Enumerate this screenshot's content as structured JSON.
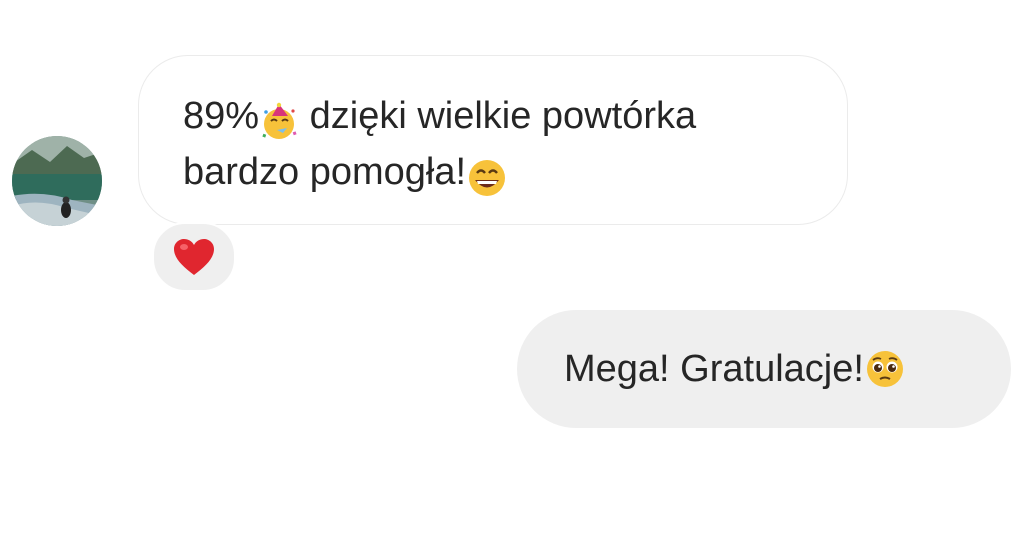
{
  "incoming_message": {
    "line1_prefix": "89%",
    "line1_emoji": "partying-face",
    "line1_text": " dzięki wielkie powtórka",
    "line2_text": "bardzo pomogła!",
    "line2_emoji": "grinning-face-with-smiling-eyes",
    "reaction_emoji": "red-heart"
  },
  "outgoing_message": {
    "text": "Mega! Gratulacje!",
    "emoji": "pleading-face"
  },
  "colors": {
    "incoming_bubble": "#ffffff",
    "incoming_border": "#ebebeb",
    "outgoing_bubble": "#efefef",
    "text": "#262626",
    "reaction_bg": "#efefef",
    "heart": "#e0262f"
  }
}
